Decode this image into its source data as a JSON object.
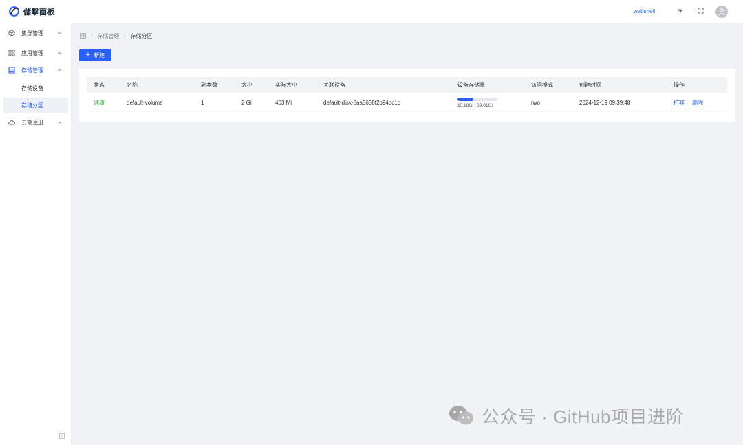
{
  "app": {
    "title": "儲擊面板"
  },
  "topbar": {
    "webshell_label": "webshell",
    "theme_icon": "☀",
    "fullscreen_icon": "⛶"
  },
  "sidebar": {
    "menus": [
      {
        "label": "集群管理",
        "icon": "cube-icon"
      },
      {
        "label": "应用管理",
        "icon": "grid-icon"
      },
      {
        "label": "存储管理",
        "icon": "storage-icon",
        "active": true,
        "children": [
          {
            "label": "存储设备"
          },
          {
            "label": "存储分区",
            "selected": true
          }
        ]
      },
      {
        "label": "云端注册",
        "icon": "cloud-icon"
      }
    ]
  },
  "breadcrumb": {
    "items": [
      "存储管理",
      "存储分区"
    ]
  },
  "toolbar": {
    "new_label": "新建",
    "new_icon": "+"
  },
  "table": {
    "headers": {
      "status": "状态",
      "name": "名称",
      "replicas": "副本数",
      "size": "大小",
      "actual": "实际大小",
      "device": "关联设备",
      "usage": "设备存储量",
      "mode": "访问模式",
      "created": "创建时间",
      "actions": "操作"
    },
    "rows": [
      {
        "status": "健康",
        "name": "default-volume",
        "replicas": "1",
        "size": "2 Gi",
        "actual": "403 Mi",
        "device": "default-disk-8aa5638f2b94bc1c",
        "usage_text": "15.18Gi / 39.01Gi",
        "usage_fraction": 0.389,
        "mode": "rwo",
        "created": "2024-12-19 09:39:48",
        "action_expand": "扩容",
        "action_delete": "删除"
      }
    ]
  },
  "watermark": {
    "text": "公众号 · GitHub项目进阶"
  },
  "colors": {
    "primary": "#2b5ff5",
    "success": "#4caf50",
    "background": "#f0f2f5"
  }
}
